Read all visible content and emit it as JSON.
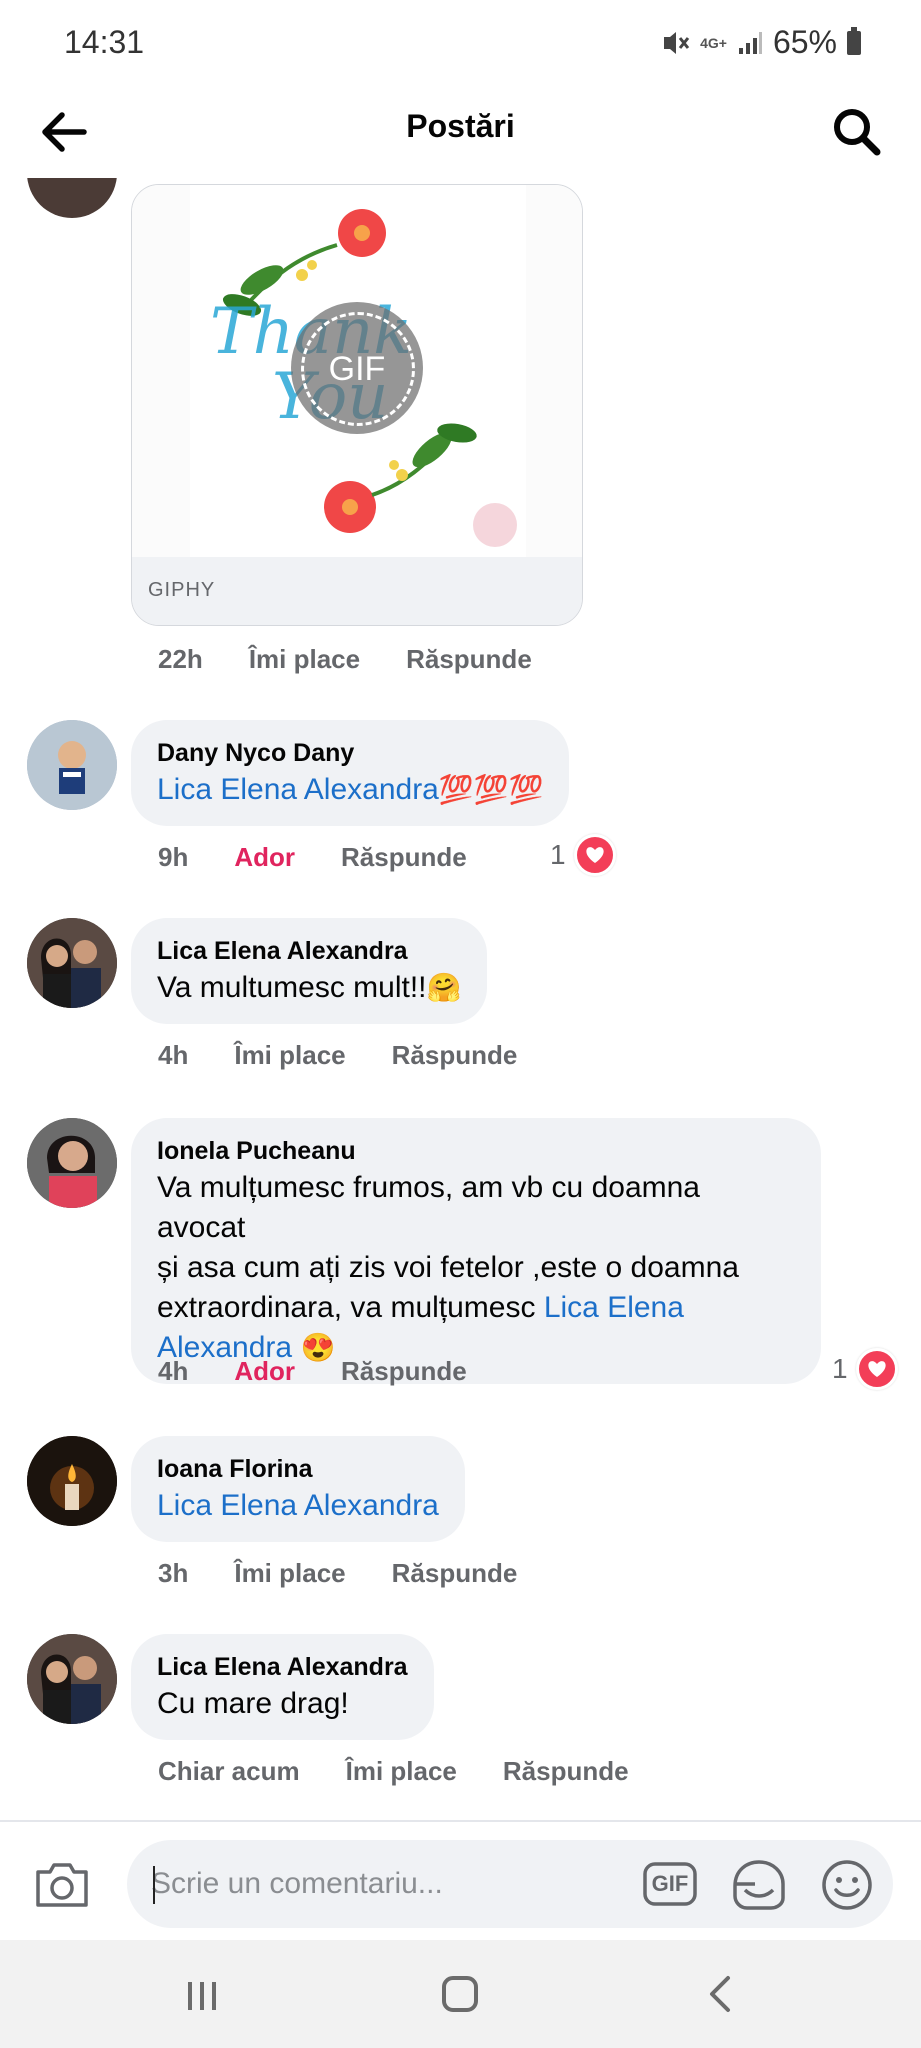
{
  "status_bar": {
    "time": "14:31",
    "network": "4G+",
    "battery": "65%"
  },
  "header": {
    "title": "Postări"
  },
  "gif_comment": {
    "source": "GIPHY",
    "badge": "GIF",
    "art_text_1": "Thank",
    "art_text_2": "You",
    "time": "22h",
    "like": "Îmi place",
    "reply": "Răspunde"
  },
  "comments": [
    {
      "author": "Dany Nyco Dany",
      "mention": "Lica Elena Alexandra",
      "emoji": "💯💯💯",
      "time": "9h",
      "like": "Ador",
      "reply": "Răspunde",
      "reaction_count": "1"
    },
    {
      "author": "Lica Elena Alexandra",
      "text": "Va multumesc mult!!",
      "emoji": "🤗",
      "time": "4h",
      "like": "Îmi place",
      "reply": "Răspunde"
    },
    {
      "author": "Ionela Pucheanu",
      "text_line1": "Va mulțumesc frumos, am vb cu doamna avocat",
      "text_line2": "și asa cum ați zis voi fetelor ,este o doamna",
      "text_line3": "extraordinara, va mulțumesc ",
      "mention_part1": "Lica Elena",
      "mention_part2": "Alexandra",
      "emoji": "😍",
      "time": "4h",
      "like": "Ador",
      "reply": "Răspunde",
      "reaction_count": "1"
    },
    {
      "author": "Ioana Florina",
      "mention": "Lica Elena Alexandra",
      "time": "3h",
      "like": "Îmi place",
      "reply": "Răspunde"
    },
    {
      "author": "Lica Elena Alexandra",
      "text": "Cu mare drag!",
      "time": "Chiar acum",
      "like": "Îmi place",
      "reply": "Răspunde"
    }
  ],
  "composer": {
    "placeholder": "Scrie un comentariu...",
    "gif_label": "GIF"
  },
  "icons": {
    "back": "arrow-left-icon",
    "search": "search-icon",
    "camera": "camera-icon",
    "sticker": "sticker-icon",
    "emoji": "smiley-icon",
    "heart": "heart-icon"
  },
  "colors": {
    "mention": "#1c6fc9",
    "love": "#e0245e",
    "bubble": "#f0f2f5",
    "meta": "#65676b"
  }
}
